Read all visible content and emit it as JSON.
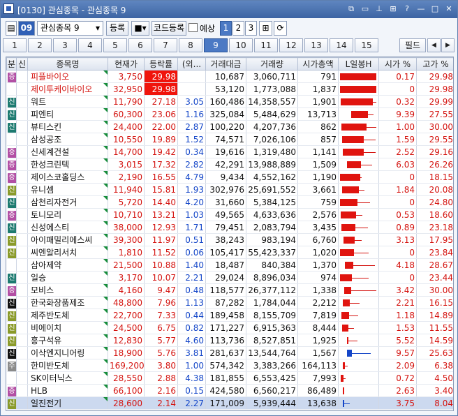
{
  "window": {
    "title": "[0130] 관심종목 - 관심종목 9"
  },
  "toolbar": {
    "code_label": "09",
    "group_select": "관심종목 9",
    "register_btn": "등록",
    "code_register_btn": "코드등록",
    "forecast_label": "예상",
    "page_buttons": [
      "1",
      "2",
      "3"
    ]
  },
  "tabs": [
    "1",
    "2",
    "3",
    "4",
    "5",
    "6",
    "7",
    "8",
    "9",
    "10",
    "11",
    "12",
    "13",
    "14",
    "15"
  ],
  "active_tab": "9",
  "field_btn": "필드",
  "columns": [
    "분",
    "신",
    "종목명",
    "현재가",
    "등락률",
    "(외...",
    "거래대금",
    "거래량",
    "시가총액",
    "L일봉H",
    "시가 %",
    "고가 %"
  ],
  "colors": {
    "up": "#d4130f",
    "down": "#1446c8",
    "limit_up_bg": "#f0140c",
    "accent": "#4b79c4"
  },
  "rows": [
    {
      "badge": "증",
      "badge_color": "#b24fa4",
      "name": "피플바이오",
      "price": "3,750",
      "rate": "29.98",
      "limit": true,
      "foreign": "",
      "amount": "10,687",
      "volume": "3,060,711",
      "mcap": "791",
      "c_open": 0.17,
      "c_high": 29.98,
      "open_pct": "0.17",
      "high_pct": "29.98"
    },
    {
      "badge": "",
      "badge_color": "",
      "name": "제이투케이바이오",
      "price": "32,950",
      "rate": "29.98",
      "limit": true,
      "foreign": "",
      "amount": "53,120",
      "volume": "1,773,088",
      "mcap": "1,837",
      "c_open": 0,
      "c_high": 29.98,
      "open_pct": "0",
      "high_pct": "29.98"
    },
    {
      "badge": "신",
      "badge_color": "#1d7a70",
      "name": "워트",
      "price": "11,790",
      "rate": "27.18",
      "limit": false,
      "foreign": "3.05",
      "amount": "160,486",
      "volume": "14,358,557",
      "mcap": "1,901",
      "c_open": 0.32,
      "c_high": 29.99,
      "open_pct": "0.32",
      "high_pct": "29.99"
    },
    {
      "badge": "신",
      "badge_color": "#1d7a70",
      "name": "피엔티",
      "price": "60,300",
      "rate": "23.06",
      "limit": false,
      "foreign": "1.16",
      "amount": "325,084",
      "volume": "5,484,629",
      "mcap": "13,713",
      "c_open": 9.39,
      "c_high": 27.55,
      "open_pct": "9.39",
      "high_pct": "27.55"
    },
    {
      "badge": "신",
      "badge_color": "#1d7a70",
      "name": "뷰티스킨",
      "price": "24,400",
      "rate": "22.00",
      "limit": false,
      "foreign": "2.87",
      "amount": "100,220",
      "volume": "4,207,736",
      "mcap": "862",
      "c_open": 1.0,
      "c_high": 30.0,
      "open_pct": "1.00",
      "high_pct": "30.00"
    },
    {
      "badge": "",
      "badge_color": "",
      "name": "삼성공조",
      "price": "10,550",
      "rate": "19.89",
      "limit": false,
      "foreign": "1.52",
      "amount": "74,571",
      "volume": "7,026,106",
      "mcap": "857",
      "c_open": 1.59,
      "c_high": 29.55,
      "open_pct": "1.59",
      "high_pct": "29.55"
    },
    {
      "badge": "증",
      "badge_color": "#b24fa4",
      "name": "신세계건설",
      "price": "14,700",
      "rate": "19.42",
      "limit": false,
      "foreign": "0.34",
      "amount": "19,616",
      "volume": "1,319,480",
      "mcap": "1,141",
      "c_open": 2.52,
      "c_high": 29.16,
      "open_pct": "2.52",
      "high_pct": "29.16"
    },
    {
      "badge": "증",
      "badge_color": "#b24fa4",
      "name": "한성크린텍",
      "price": "3,015",
      "rate": "17.32",
      "limit": false,
      "foreign": "2.82",
      "amount": "42,291",
      "volume": "13,988,889",
      "mcap": "1,509",
      "c_open": 6.03,
      "c_high": 26.26,
      "open_pct": "6.03",
      "high_pct": "26.26"
    },
    {
      "badge": "증",
      "badge_color": "#b24fa4",
      "name": "제이스코홀딩스",
      "price": "2,190",
      "rate": "16.55",
      "limit": false,
      "foreign": "4.79",
      "amount": "9,434",
      "volume": "4,552,162",
      "mcap": "1,190",
      "c_open": 0,
      "c_high": 18.15,
      "open_pct": "0",
      "high_pct": "18.15"
    },
    {
      "badge": "신",
      "badge_color": "#8a9a2a",
      "name": "유니셈",
      "price": "11,940",
      "rate": "15.81",
      "limit": false,
      "foreign": "1.93",
      "amount": "302,976",
      "volume": "25,691,552",
      "mcap": "3,661",
      "c_open": 1.84,
      "c_high": 20.08,
      "open_pct": "1.84",
      "high_pct": "20.08"
    },
    {
      "badge": "신",
      "badge_color": "#1d7a70",
      "name": "삼천리자전거",
      "price": "5,720",
      "rate": "14.40",
      "limit": false,
      "foreign": "4.20",
      "amount": "31,660",
      "volume": "5,384,125",
      "mcap": "759",
      "c_open": 0,
      "c_high": 24.8,
      "open_pct": "0",
      "high_pct": "24.80"
    },
    {
      "badge": "증",
      "badge_color": "#b24fa4",
      "name": "토니모리",
      "price": "10,710",
      "rate": "13.21",
      "limit": false,
      "foreign": "1.03",
      "amount": "49,565",
      "volume": "4,633,636",
      "mcap": "2,576",
      "c_open": 0.53,
      "c_high": 18.6,
      "open_pct": "0.53",
      "high_pct": "18.60"
    },
    {
      "badge": "신",
      "badge_color": "#1d7a70",
      "name": "신성에스티",
      "price": "38,000",
      "rate": "12.93",
      "limit": false,
      "foreign": "1.71",
      "amount": "79,451",
      "volume": "2,083,794",
      "mcap": "3,435",
      "c_open": 0.89,
      "c_high": 23.18,
      "open_pct": "0.89",
      "high_pct": "23.18"
    },
    {
      "badge": "신",
      "badge_color": "#8a9a2a",
      "name": "아이패밀리에스씨",
      "price": "39,300",
      "rate": "11.97",
      "limit": false,
      "foreign": "0.51",
      "amount": "38,243",
      "volume": "983,194",
      "mcap": "6,760",
      "c_open": 3.13,
      "c_high": 17.95,
      "open_pct": "3.13",
      "high_pct": "17.95"
    },
    {
      "badge": "신",
      "badge_color": "#8a9a2a",
      "name": "씨엔알리서치",
      "price": "1,810",
      "rate": "11.52",
      "limit": false,
      "foreign": "0.06",
      "amount": "105,417",
      "volume": "55,423,337",
      "mcap": "1,020",
      "c_open": 0,
      "c_high": 23.84,
      "open_pct": "0",
      "high_pct": "23.84"
    },
    {
      "badge": "",
      "badge_color": "",
      "name": "삼아제약",
      "price": "21,500",
      "rate": "10.88",
      "limit": false,
      "foreign": "1.40",
      "amount": "18,487",
      "volume": "840,384",
      "mcap": "1,370",
      "c_open": 4.18,
      "c_high": 28.67,
      "open_pct": "4.18",
      "high_pct": "28.67"
    },
    {
      "badge": "신",
      "badge_color": "#1d7a70",
      "name": "일승",
      "price": "3,170",
      "rate": "10.07",
      "limit": false,
      "foreign": "2.21",
      "amount": "29,024",
      "volume": "8,896,034",
      "mcap": "974",
      "c_open": 0,
      "c_high": 23.44,
      "open_pct": "0",
      "high_pct": "23.44"
    },
    {
      "badge": "증",
      "badge_color": "#b24fa4",
      "name": "모비스",
      "price": "4,160",
      "rate": "9.47",
      "limit": false,
      "foreign": "0.48",
      "amount": "118,577",
      "volume": "26,377,112",
      "mcap": "1,338",
      "c_open": 3.42,
      "c_high": 30.0,
      "open_pct": "3.42",
      "high_pct": "30.00"
    },
    {
      "badge": "신",
      "badge_color": "#111111",
      "name": "한국화장품제조",
      "price": "48,800",
      "rate": "7.96",
      "limit": false,
      "foreign": "1.13",
      "amount": "87,282",
      "volume": "1,784,044",
      "mcap": "2,212",
      "c_open": 2.21,
      "c_high": 16.15,
      "open_pct": "2.21",
      "high_pct": "16.15"
    },
    {
      "badge": "신",
      "badge_color": "#8a9a2a",
      "name": "제주반도체",
      "price": "22,700",
      "rate": "7.33",
      "limit": false,
      "foreign": "0.44",
      "amount": "189,458",
      "volume": "8,155,709",
      "mcap": "7,819",
      "c_open": 1.18,
      "c_high": 14.89,
      "open_pct": "1.18",
      "high_pct": "14.89"
    },
    {
      "badge": "신",
      "badge_color": "#8a9a2a",
      "name": "비에이치",
      "price": "24,500",
      "rate": "6.75",
      "limit": false,
      "foreign": "0.82",
      "amount": "171,227",
      "volume": "6,915,363",
      "mcap": "8,444",
      "c_open": 1.53,
      "c_high": 11.55,
      "open_pct": "1.53",
      "high_pct": "11.55"
    },
    {
      "badge": "신",
      "badge_color": "#8a9a2a",
      "name": "흥구석유",
      "price": "12,830",
      "rate": "5.77",
      "limit": false,
      "foreign": "4.60",
      "amount": "113,736",
      "volume": "8,527,851",
      "mcap": "1,925",
      "c_open": 5.52,
      "c_high": 14.59,
      "open_pct": "5.52",
      "high_pct": "14.59"
    },
    {
      "badge": "신",
      "badge_color": "#111111",
      "name": "이삭엔지니어링",
      "price": "18,900",
      "rate": "5.76",
      "limit": false,
      "foreign": "3.81",
      "amount": "281,637",
      "volume": "13,544,764",
      "mcap": "1,567",
      "c_open": 9.57,
      "c_high": 25.63,
      "open_pct": "9.57",
      "high_pct": "25.63",
      "candle_blue": true
    },
    {
      "badge": "주",
      "badge_color": "#8a8a8a",
      "name": "한미반도체",
      "price": "169,200",
      "rate": "3.80",
      "limit": false,
      "foreign": "1.00",
      "amount": "574,342",
      "volume": "3,383,266",
      "mcap": "164,113",
      "c_open": 2.09,
      "c_high": 6.38,
      "open_pct": "2.09",
      "high_pct": "6.38"
    },
    {
      "badge": "",
      "badge_color": "",
      "name": "SK이터닉스",
      "price": "28,550",
      "rate": "2.88",
      "limit": false,
      "foreign": "4.38",
      "amount": "181,855",
      "volume": "6,553,425",
      "mcap": "7,993",
      "c_open": 0.72,
      "c_high": 4.5,
      "open_pct": "0.72",
      "high_pct": "4.50"
    },
    {
      "badge": "증",
      "badge_color": "#b24fa4",
      "name": "HLB",
      "price": "66,100",
      "rate": "2.16",
      "limit": false,
      "foreign": "0.15",
      "amount": "424,580",
      "volume": "6,560,217",
      "mcap": "86,489",
      "c_open": 2.63,
      "c_high": 3.4,
      "open_pct": "2.63",
      "high_pct": "3.40"
    },
    {
      "badge": "신",
      "badge_color": "#8a9a2a",
      "name": "일진전기",
      "price": "28,600",
      "rate": "2.14",
      "limit": false,
      "foreign": "2.27",
      "amount": "171,009",
      "volume": "5,939,444",
      "mcap": "13,638",
      "c_open": 3.75,
      "c_high": 8.04,
      "open_pct": "3.75",
      "high_pct": "8.04",
      "selected": true,
      "candle_blue": true
    }
  ]
}
